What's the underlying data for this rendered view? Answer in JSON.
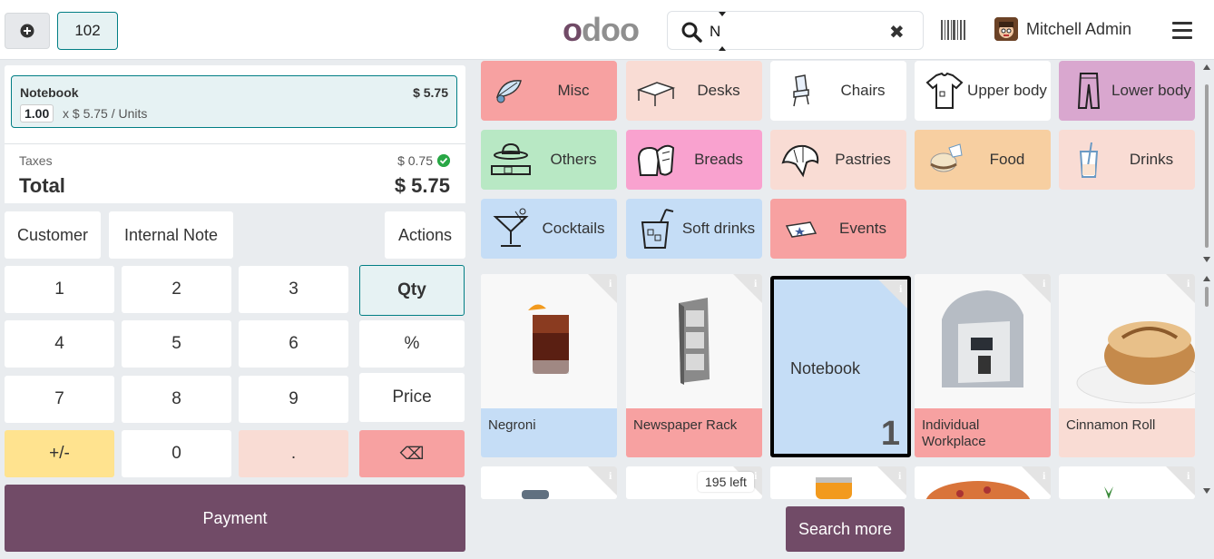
{
  "header": {
    "order_number": "102",
    "logo_text_first": "o",
    "logo_text_rest": "doo",
    "search_value": "N",
    "user_name": "Mitchell Admin"
  },
  "order": {
    "line": {
      "name": "Notebook",
      "price": "$ 5.75",
      "qty": "1.00",
      "unit_text": "x $ 5.75 / Units"
    },
    "taxes_label": "Taxes",
    "taxes_value": "$ 0.75",
    "total_label": "Total",
    "total_value": "$ 5.75"
  },
  "controls": {
    "customer": "Customer",
    "internal_note": "Internal Note",
    "actions": "Actions"
  },
  "numpad": {
    "k1": "1",
    "k2": "2",
    "k3": "3",
    "k4": "4",
    "k5": "5",
    "k6": "6",
    "k7": "7",
    "k8": "8",
    "k9": "9",
    "kpm": "+/-",
    "k0": "0",
    "kdot": ".",
    "kback": "⌫",
    "qty": "Qty",
    "pct": "%",
    "price": "Price"
  },
  "payment_label": "Payment",
  "categories": [
    {
      "label": "Misc",
      "color": "#f7a1a1"
    },
    {
      "label": "Desks",
      "color": "#f9dcd4"
    },
    {
      "label": "Chairs",
      "color": "#ffffff"
    },
    {
      "label": "Upper body",
      "color": "#ffffff"
    },
    {
      "label": "Lower body",
      "color": "#d9a7cf"
    },
    {
      "label": "Others",
      "color": "#b8e8c4"
    },
    {
      "label": "Breads",
      "color": "#f9a2cf"
    },
    {
      "label": "Pastries",
      "color": "#f9dcd4"
    },
    {
      "label": "Food",
      "color": "#f7cfa1"
    },
    {
      "label": "Drinks",
      "color": "#f9dcd4"
    },
    {
      "label": "Cocktails",
      "color": "#c5ddf6"
    },
    {
      "label": "Soft drinks",
      "color": "#c5ddf6"
    },
    {
      "label": "Events",
      "color": "#f7a1a1"
    }
  ],
  "products": [
    {
      "name": "Negroni",
      "color": "#c5ddf6"
    },
    {
      "name": "Newspaper Rack",
      "color": "#f7a1a1"
    },
    {
      "name": "Notebook",
      "color": "#c5ddf6",
      "qty": "1"
    },
    {
      "name": "Individual Workplace",
      "color": "#f7a1a1"
    },
    {
      "name": "Cinnamon Roll",
      "color": "#f9dcd4"
    }
  ],
  "stock_badge": "195 left",
  "search_more": "Search more"
}
